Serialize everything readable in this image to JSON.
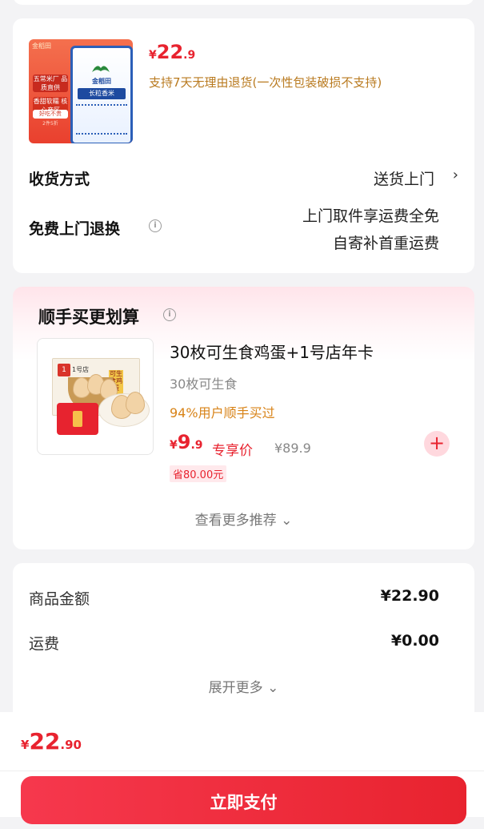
{
  "product": {
    "image_texts": {
      "brand": "金稻田",
      "tag1": "五常米厂 品质直供",
      "tag2": "香甜软糯 核心产区",
      "tag3": "好吃不贵",
      "tag4": "2件5折",
      "bag_brand": "金稻田",
      "bag_band": "长粒香米"
    },
    "price_symbol": "¥",
    "price_int": "22",
    "price_dec": ".9",
    "return_note": "支持7天无理由退货(一次性包装破损不支持)"
  },
  "delivery": {
    "label": "收货方式",
    "value": "送货上门",
    "chevron": "›"
  },
  "free_return": {
    "label": "免费上门退换",
    "info_icon": "i",
    "line1": "上门取件享运费全免",
    "line2": "自寄补首重运费"
  },
  "recommendation": {
    "title": "顺手买更划算",
    "info_icon": "i",
    "item": {
      "name": "30枚可生食鸡蛋+1号店年卡",
      "subtitle": "30枚可生食",
      "stat": "94%用户顺手买过",
      "price_symbol": "¥",
      "price_int": "9",
      "price_dec": ".9",
      "price_tag": "专享价",
      "original_price": "¥89.9",
      "saving": "省80.00元",
      "image_texts": {
        "brand_mark": "1",
        "brand_text": "1号店",
        "box_tag": "可生食鸡蛋"
      },
      "add_button": "+"
    },
    "more_link": "查看更多推荐 ⌄"
  },
  "summary": {
    "rows": [
      {
        "label": "商品金额",
        "value": "¥22.90"
      },
      {
        "label": "运费",
        "value": "¥0.00"
      }
    ],
    "expand_link": "展开更多 ⌄"
  },
  "bottom": {
    "total_symbol": "¥",
    "total_int": "22",
    "total_dec": ".90",
    "pay_button": "立即支付"
  },
  "colors": {
    "accent": "#e8232f",
    "note": "#b97a1f",
    "stat": "#d88318",
    "background": "#f3f3f5"
  }
}
